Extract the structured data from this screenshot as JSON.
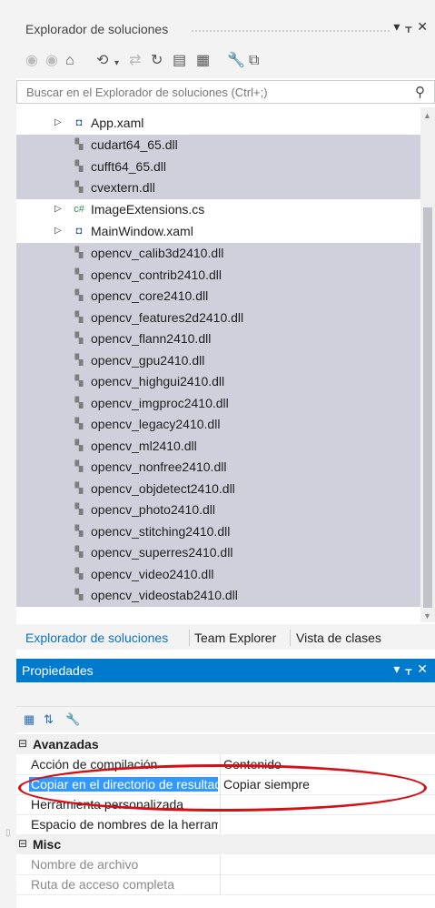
{
  "solution_explorer": {
    "title": "Explorador de soluciones",
    "pin": "▔",
    "search_placeholder": "Buscar en el Explorador de soluciones (Ctrl+;)",
    "items": [
      {
        "label": "App.xaml",
        "icon": "xaml-file-icon",
        "expandable": true
      },
      {
        "label": "cudart64_65.dll",
        "icon": "dll-file-icon",
        "expandable": false
      },
      {
        "label": "cufft64_65.dll",
        "icon": "dll-file-icon",
        "expandable": false
      },
      {
        "label": "cvextern.dll",
        "icon": "dll-file-icon",
        "expandable": false
      },
      {
        "label": "ImageExtensions.cs",
        "icon": "csharp-file-icon",
        "expandable": true
      },
      {
        "label": "MainWindow.xaml",
        "icon": "xaml-file-icon",
        "expandable": true
      },
      {
        "label": "opencv_calib3d2410.dll",
        "icon": "dll-file-icon",
        "expandable": false
      },
      {
        "label": "opencv_contrib2410.dll",
        "icon": "dll-file-icon",
        "expandable": false
      },
      {
        "label": "opencv_core2410.dll",
        "icon": "dll-file-icon",
        "expandable": false
      },
      {
        "label": "opencv_features2d2410.dll",
        "icon": "dll-file-icon",
        "expandable": false
      },
      {
        "label": "opencv_flann2410.dll",
        "icon": "dll-file-icon",
        "expandable": false
      },
      {
        "label": "opencv_gpu2410.dll",
        "icon": "dll-file-icon",
        "expandable": false
      },
      {
        "label": "opencv_highgui2410.dll",
        "icon": "dll-file-icon",
        "expandable": false
      },
      {
        "label": "opencv_imgproc2410.dll",
        "icon": "dll-file-icon",
        "expandable": false
      },
      {
        "label": "opencv_legacy2410.dll",
        "icon": "dll-file-icon",
        "expandable": false
      },
      {
        "label": "opencv_ml2410.dll",
        "icon": "dll-file-icon",
        "expandable": false
      },
      {
        "label": "opencv_nonfree2410.dll",
        "icon": "dll-file-icon",
        "expandable": false
      },
      {
        "label": "opencv_objdetect2410.dll",
        "icon": "dll-file-icon",
        "expandable": false
      },
      {
        "label": "opencv_photo2410.dll",
        "icon": "dll-file-icon",
        "expandable": false
      },
      {
        "label": "opencv_stitching2410.dll",
        "icon": "dll-file-icon",
        "expandable": false
      },
      {
        "label": "opencv_superres2410.dll",
        "icon": "dll-file-icon",
        "expandable": false
      },
      {
        "label": "opencv_video2410.dll",
        "icon": "dll-file-icon",
        "expandable": false
      },
      {
        "label": "opencv_videostab2410.dll",
        "icon": "dll-file-icon",
        "expandable": false
      }
    ]
  },
  "tabs": [
    {
      "label": "Explorador de soluciones",
      "active": true
    },
    {
      "label": "Team Explorer",
      "active": false
    },
    {
      "label": "Vista de clases",
      "active": false
    }
  ],
  "properties": {
    "title": "Propiedades",
    "categories": [
      {
        "name": "Avanzadas",
        "rows": [
          {
            "name": "Acción de compilación",
            "value": "Contenido"
          },
          {
            "name": "Copiar en el directorio de resultados",
            "value": "Copiar siempre",
            "selected": true
          },
          {
            "name": "Herramienta personalizada",
            "value": ""
          },
          {
            "name": "Espacio de nombres de la herramienta personalizada",
            "value": ""
          }
        ]
      },
      {
        "name": "Misc",
        "rows": [
          {
            "name": "Nombre de archivo",
            "value": "",
            "dim": true
          },
          {
            "name": "Ruta de acceso completa",
            "value": "",
            "dim": true
          }
        ]
      }
    ]
  },
  "colors": {
    "accent": "#007acc",
    "selection_row": "#d0d0dc",
    "selected_property": "#3399ff",
    "annotation": "#d50f15"
  }
}
